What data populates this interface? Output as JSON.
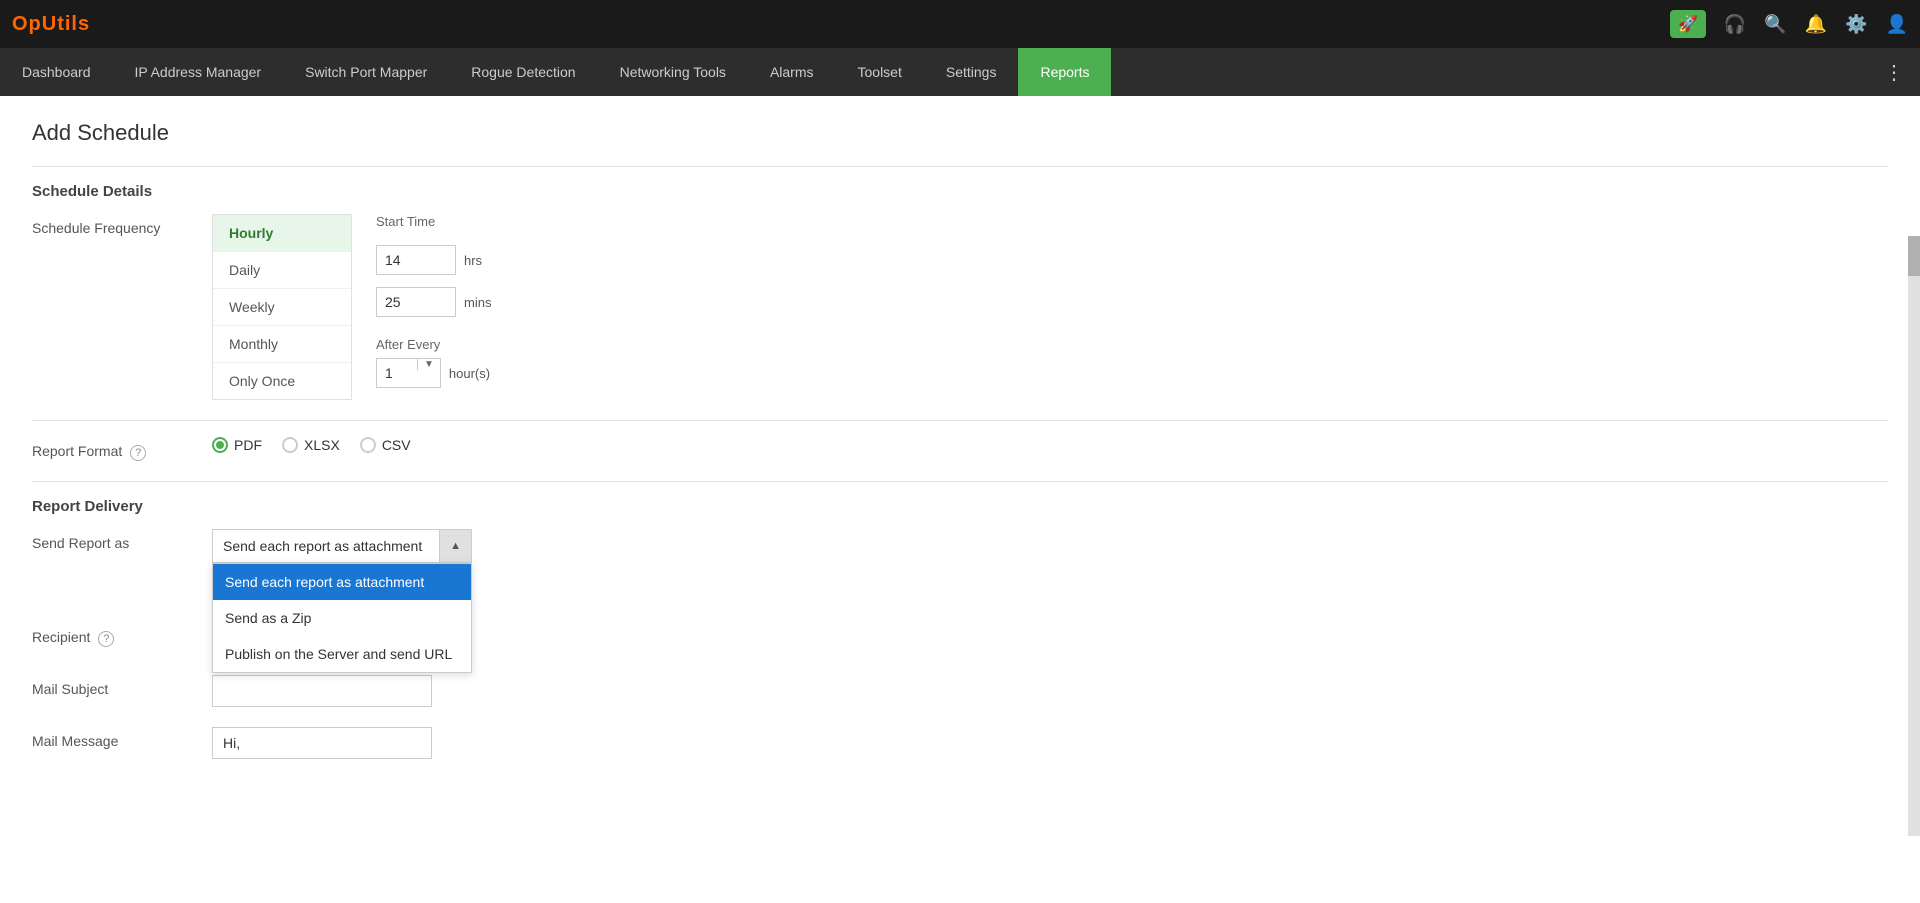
{
  "app": {
    "logo": "OpUtils"
  },
  "topbar": {
    "icons": [
      "rocket",
      "headset",
      "search",
      "bell",
      "gear",
      "user"
    ]
  },
  "navbar": {
    "items": [
      {
        "label": "Dashboard",
        "active": false
      },
      {
        "label": "IP Address Manager",
        "active": false
      },
      {
        "label": "Switch Port Mapper",
        "active": false
      },
      {
        "label": "Rogue Detection",
        "active": false
      },
      {
        "label": "Networking Tools",
        "active": false
      },
      {
        "label": "Alarms",
        "active": false
      },
      {
        "label": "Toolset",
        "active": false
      },
      {
        "label": "Settings",
        "active": false
      },
      {
        "label": "Reports",
        "active": true
      }
    ]
  },
  "page": {
    "title": "Add Schedule"
  },
  "schedule_details": {
    "section_title": "Schedule Details",
    "frequency_label": "Schedule Frequency",
    "frequencies": [
      {
        "label": "Hourly",
        "active": true
      },
      {
        "label": "Daily",
        "active": false
      },
      {
        "label": "Weekly",
        "active": false
      },
      {
        "label": "Monthly",
        "active": false
      },
      {
        "label": "Only Once",
        "active": false
      }
    ],
    "start_time_label": "Start Time",
    "hours_value": "14",
    "hours_unit": "hrs",
    "mins_value": "25",
    "mins_unit": "mins",
    "after_every_label": "After Every",
    "after_every_value": "1",
    "after_every_unit": "hour(s)"
  },
  "report_format": {
    "section_title": "Report Format",
    "label": "Report Format",
    "help": "?",
    "options": [
      {
        "label": "PDF",
        "checked": true
      },
      {
        "label": "XLSX",
        "checked": false
      },
      {
        "label": "CSV",
        "checked": false
      }
    ]
  },
  "report_delivery": {
    "section_title": "Report Delivery",
    "send_report_as_label": "Send Report as",
    "dropdown_value": "Send each report as attachment",
    "dropdown_options": [
      {
        "label": "Send each report as attachment",
        "selected": true
      },
      {
        "label": "Send as a Zip",
        "selected": false
      },
      {
        "label": "Publish on the Server and send URL",
        "selected": false
      }
    ],
    "recipient_label": "Recipient",
    "recipient_help": "?",
    "recipient_value": "",
    "mail_subject_label": "Mail Subject",
    "mail_subject_value": "",
    "mail_message_label": "Mail Message",
    "mail_message_value": "Hi,"
  }
}
